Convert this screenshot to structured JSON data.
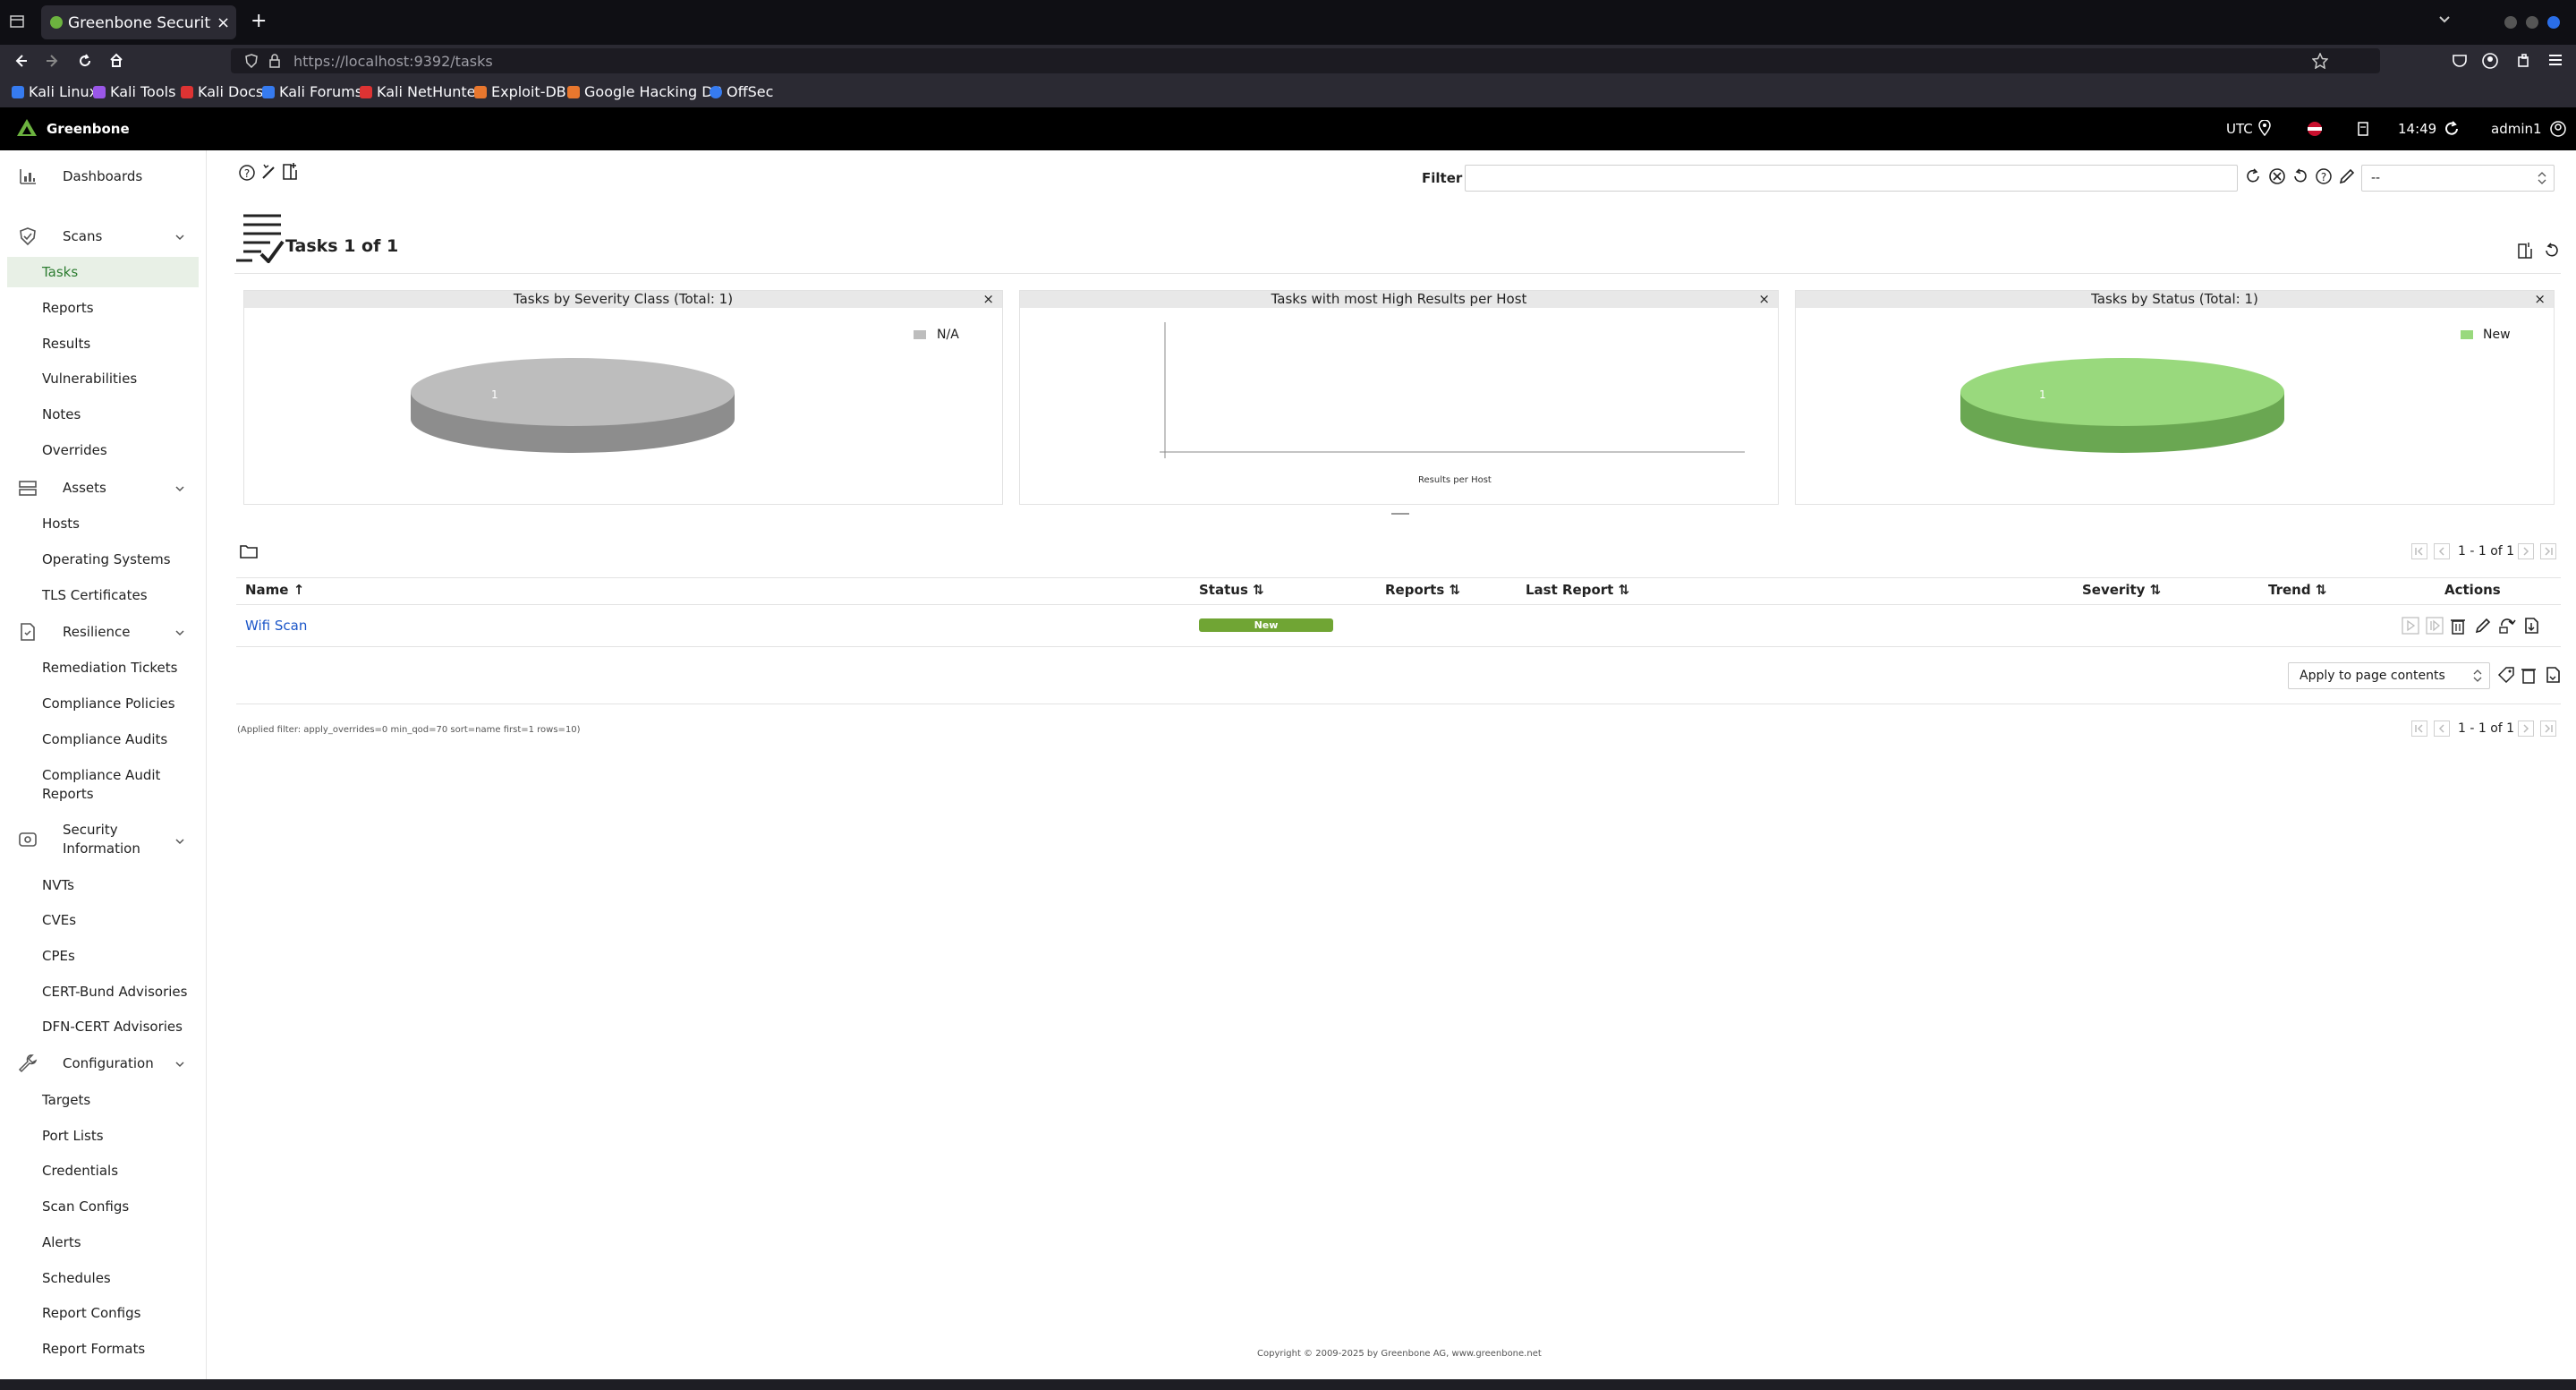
{
  "browser": {
    "tab_title": "Greenbone Security Assis",
    "url": "https://localhost:9392/tasks",
    "bookmarks": [
      "Kali Linux",
      "Kali Tools",
      "Kali Docs",
      "Kali Forums",
      "Kali NetHunter",
      "Exploit-DB",
      "Google Hacking DB",
      "OffSec"
    ]
  },
  "header": {
    "brand": "Greenbone",
    "timezone": "UTC",
    "time": "14:49",
    "user": "admin1"
  },
  "sidebar": {
    "dashboards": "Dashboards",
    "scans": {
      "label": "Scans",
      "items": [
        "Tasks",
        "Reports",
        "Results",
        "Vulnerabilities",
        "Notes",
        "Overrides"
      ]
    },
    "assets": {
      "label": "Assets",
      "items": [
        "Hosts",
        "Operating Systems",
        "TLS Certificates"
      ]
    },
    "resilience": {
      "label": "Resilience",
      "items": [
        "Remediation Tickets",
        "Compliance Policies",
        "Compliance Audits",
        "Compliance Audit",
        "Reports"
      ]
    },
    "secinfo": {
      "label1": "Security",
      "label2": "Information",
      "items": [
        "NVTs",
        "CVEs",
        "CPEs",
        "CERT-Bund Advisories",
        "DFN-CERT Advisories"
      ]
    },
    "config": {
      "label": "Configuration",
      "items": [
        "Targets",
        "Port Lists",
        "Credentials",
        "Scan Configs",
        "Alerts",
        "Schedules",
        "Report Configs",
        "Report Formats"
      ]
    }
  },
  "toolbar": {
    "filter_label": "Filter",
    "filter_value": "",
    "select_value": "--"
  },
  "page": {
    "title": "Tasks 1 of 1"
  },
  "dashboards": {
    "severity": {
      "title": "Tasks by Severity Class (Total: 1)",
      "legend": "N/A",
      "count": "1",
      "color": "#bdbdbd",
      "color_dark": "#8d8d8d"
    },
    "high_results": {
      "title": "Tasks with most High Results per Host",
      "xlabel": "Results per Host"
    },
    "status": {
      "title": "Tasks by Status (Total: 1)",
      "legend": "New",
      "count": "1",
      "color": "#99d97d",
      "color_dark": "#6aa752"
    }
  },
  "table": {
    "headers": {
      "name": "Name",
      "status": "Status",
      "reports": "Reports",
      "last_report": "Last Report",
      "severity": "Severity",
      "trend": "Trend",
      "actions": "Actions"
    },
    "rows": [
      {
        "name": "Wifi Scan",
        "status": "New",
        "status_color": "#70a534"
      }
    ],
    "pager_top": "1 - 1 of 1",
    "pager_bottom": "1 - 1 of 1",
    "bulk_select": "Apply to page contents",
    "applied_filter": "(Applied filter: apply_overrides=0 min_qod=70 sort=name first=1 rows=10)"
  },
  "footer": {
    "copyright": "Copyright © 2009-2025 by Greenbone AG, www.greenbone.net"
  }
}
